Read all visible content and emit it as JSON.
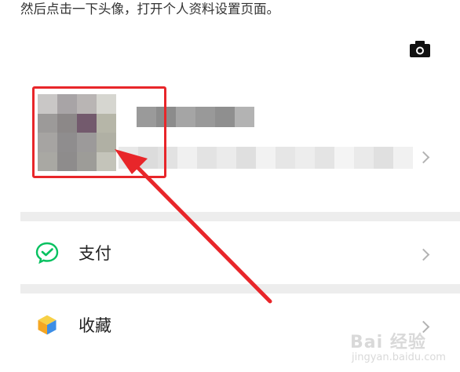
{
  "caption": "然后点击一下头像，打开个人资料设置页面。",
  "menu": [
    {
      "label": "支付",
      "icon": "wechat-pay-icon",
      "icon_color": "#07c160"
    },
    {
      "label": "收藏",
      "icon": "favorites-cube-icon",
      "icon_color": "#f5a623"
    }
  ],
  "watermark": {
    "brand": "Bai 经验",
    "url": "jingyan.baidu.com"
  },
  "colors": {
    "highlight": "#e8262a",
    "divider": "#ededed",
    "chevron": "#b3b3b3"
  }
}
